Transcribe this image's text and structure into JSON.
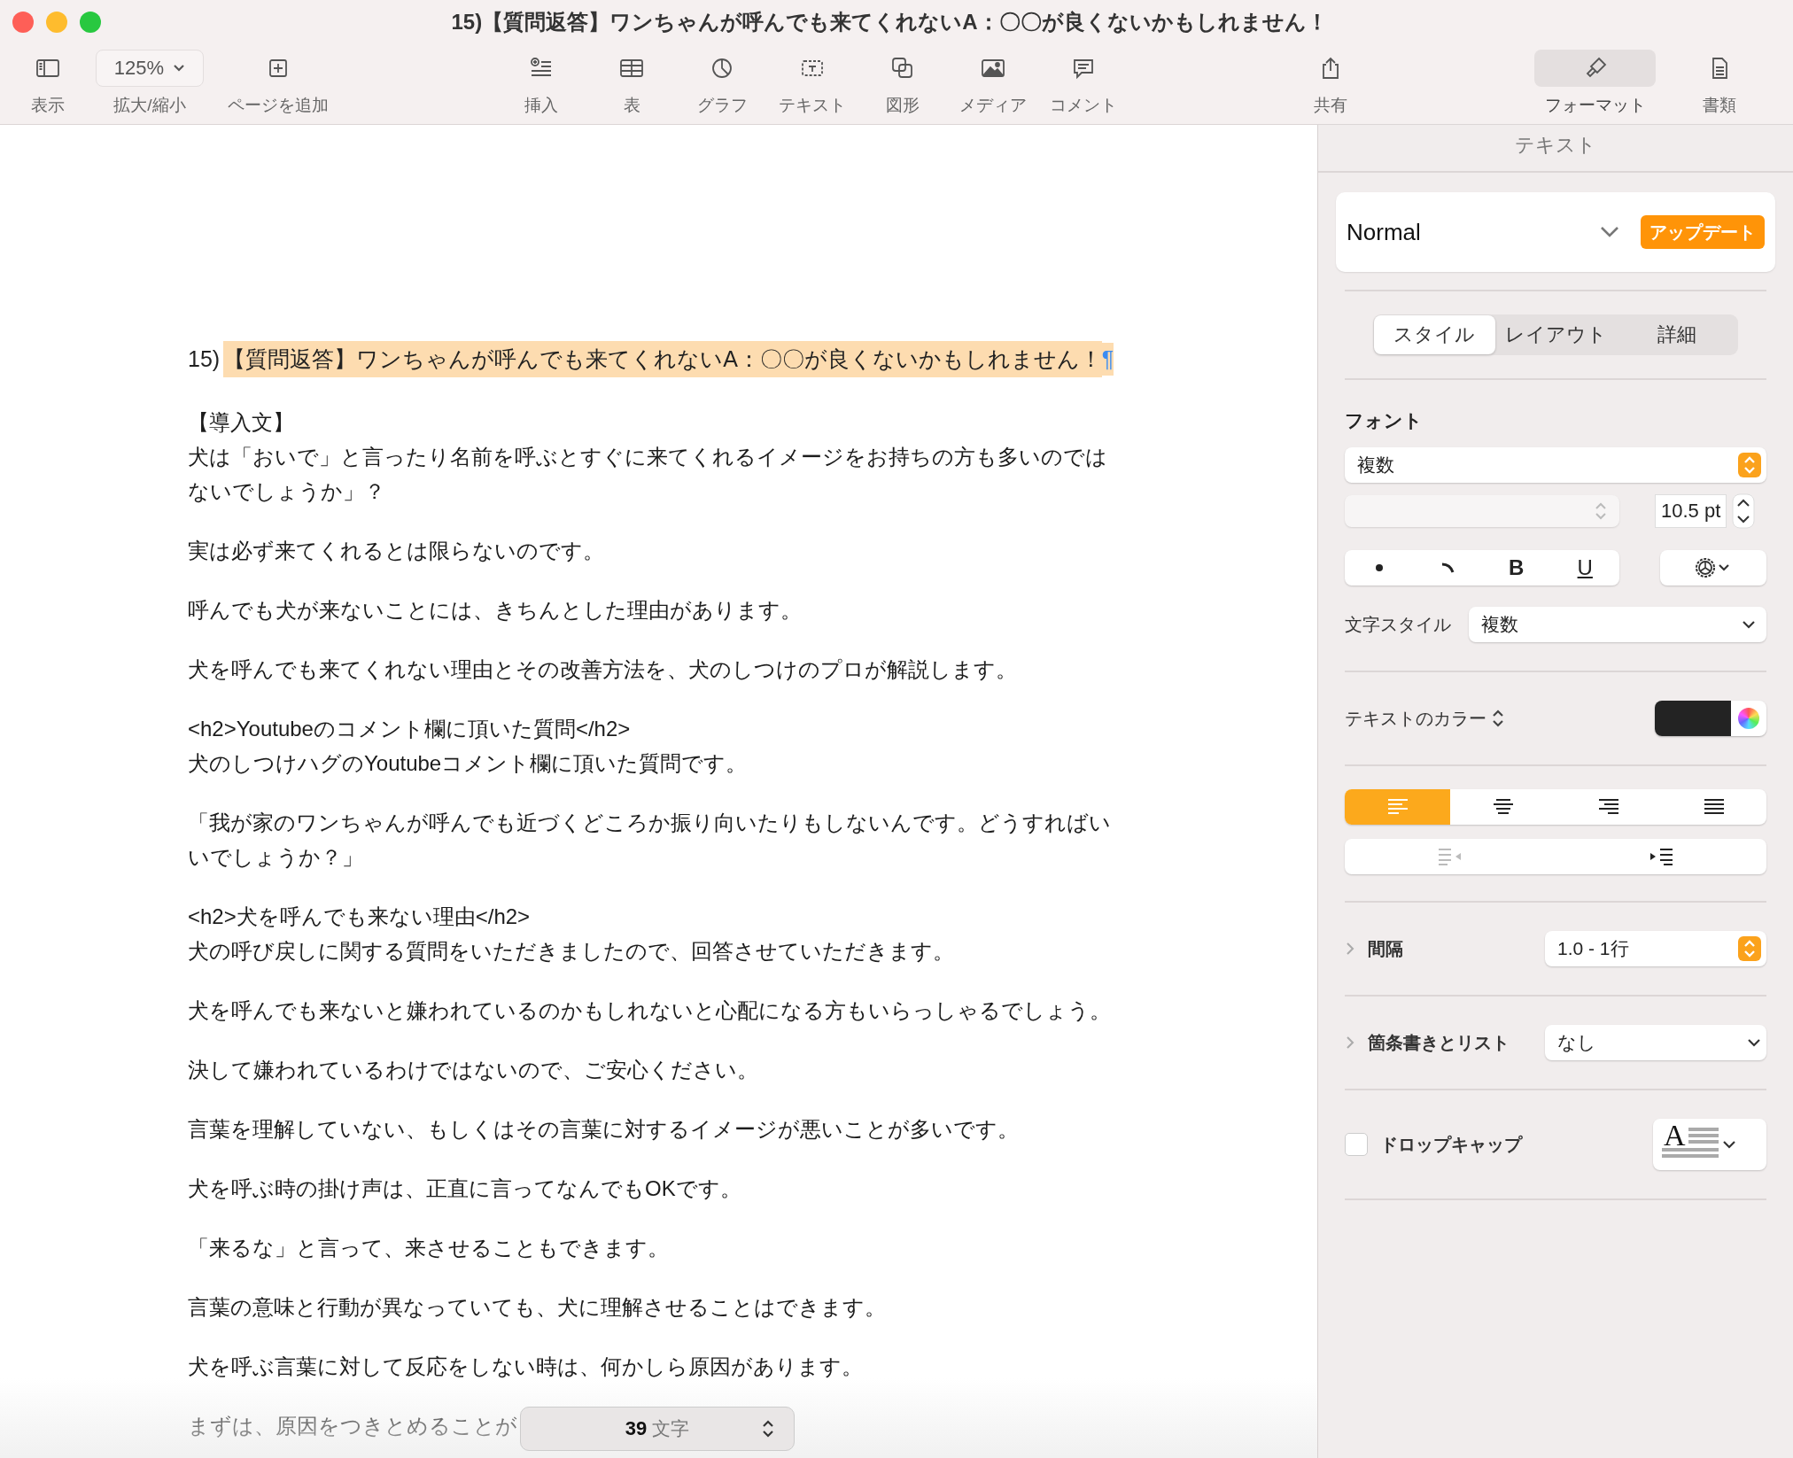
{
  "window": {
    "title": "15)【質問返答】ワンちゃんが呼んでも来てくれないA：〇〇が良くないかもしれません！"
  },
  "toolbar": [
    {
      "kind": "view",
      "label": "表示",
      "selected": false
    },
    {
      "kind": "zoom",
      "label": "拡大/縮小",
      "value": "125%",
      "selected": false
    },
    {
      "kind": "addpage",
      "label": "ページを追加",
      "selected": false
    },
    {
      "kind": "insert",
      "label": "挿入",
      "selected": false
    },
    {
      "kind": "table",
      "label": "表",
      "selected": false
    },
    {
      "kind": "chart",
      "label": "グラフ",
      "selected": false
    },
    {
      "kind": "textbox",
      "label": "テキスト",
      "selected": false
    },
    {
      "kind": "shape",
      "label": "図形",
      "selected": false
    },
    {
      "kind": "media",
      "label": "メディア",
      "selected": false
    },
    {
      "kind": "comment",
      "label": "コメント",
      "selected": false
    },
    {
      "kind": "share",
      "label": "共有",
      "selected": false
    },
    {
      "kind": "format",
      "label": "フォーマット",
      "selected": true
    },
    {
      "kind": "document",
      "label": "書類",
      "selected": false
    }
  ],
  "document": {
    "heading": {
      "number": "15)",
      "text": "【質問返答】ワンちゃんが呼んでも来てくれないA：〇〇が良くないかもしれません！",
      "pilcrow": "¶"
    },
    "blocks": [
      [
        "【導入文】",
        "犬は「おいで」と言ったり名前を呼ぶとすぐに来てくれるイメージをお持ちの方も多いのではないでしょうか」？"
      ],
      [
        "実は必ず来てくれるとは限らないのです。"
      ],
      [
        "呼んでも犬が来ないことには、きちんとした理由があります。"
      ],
      [
        "犬を呼んでも来てくれない理由とその改善方法を、犬のしつけのプロが解説します。"
      ],
      [
        "<h2>Youtubeのコメント欄に頂いた質問</h2>",
        "犬のしつけハグのYoutubeコメント欄に頂いた質問です。"
      ],
      [
        "「我が家のワンちゃんが呼んでも近づくどころか振り向いたりもしないんです。どうすればいいでしょうか？」"
      ],
      [
        "<h2>犬を呼んでも来ない理由</h2>",
        "犬の呼び戻しに関する質問をいただきましたので、回答させていただきます。"
      ],
      [
        "犬を呼んでも来ないと嫌われているのかもしれないと心配になる方もいらっしゃるでしょう。"
      ],
      [
        "決して嫌われているわけではないので、ご安心ください。"
      ],
      [
        "言葉を理解していない、もしくはその言葉に対するイメージが悪いことが多いです。"
      ],
      [
        "犬を呼ぶ時の掛け声は、正直に言ってなんでもOKです。"
      ],
      [
        "「来るな」と言って、来させることもできます。"
      ],
      [
        "言葉の意味と行動が異なっていても、犬に理解させることはできます。"
      ],
      [
        "犬を呼ぶ言葉に対して反応をしない時は、何かしら原因があります。"
      ],
      [
        "まずは、原因をつきとめることが"
      ]
    ],
    "word_count": {
      "count": "39",
      "unit": "文字"
    }
  },
  "sidebar": {
    "title": "テキスト",
    "style": {
      "name": "Normal",
      "update_button": "アップデート"
    },
    "tabs": [
      {
        "label": "スタイル",
        "selected": true
      },
      {
        "label": "レイアウト",
        "selected": false
      },
      {
        "label": "詳細",
        "selected": false
      }
    ],
    "font": {
      "heading": "フォント",
      "family": "複数",
      "size": "10.5 pt",
      "bold": "B",
      "underline": "U"
    },
    "character_style": {
      "label": "文字スタイル",
      "value": "複数"
    },
    "text_color": {
      "label": "テキストのカラー",
      "color": "#232323"
    },
    "alignment": [
      {
        "kind": "left",
        "selected": true
      },
      {
        "kind": "center",
        "selected": false
      },
      {
        "kind": "right",
        "selected": false
      },
      {
        "kind": "justify",
        "selected": false
      }
    ],
    "indent": [
      {
        "kind": "decrease",
        "disabled": true
      },
      {
        "kind": "increase",
        "disabled": false
      }
    ],
    "spacing": {
      "label": "間隔",
      "value": "1.0 - 1行"
    },
    "bullets": {
      "label": "箇条書きとリスト",
      "value": "なし"
    },
    "drop_cap": {
      "label": "ドロップキャップ",
      "checked": false,
      "preview_letter": "A"
    }
  }
}
